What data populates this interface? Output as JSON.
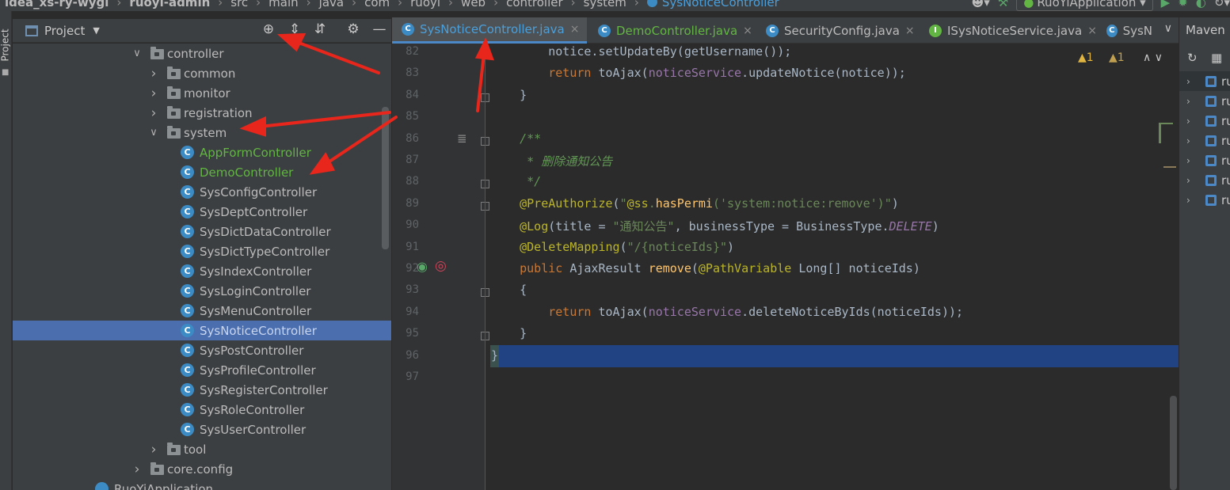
{
  "breadcrumb": {
    "items": [
      "idea_xs-ry-wygl",
      "ruoyi-admin",
      "src",
      "main",
      "java",
      "com",
      "ruoyi",
      "web",
      "controller",
      "system"
    ],
    "current": "SysNoticeController"
  },
  "run_config": "RuoYiApplication",
  "project_panel": {
    "title": "Project",
    "tree": [
      {
        "label": "controller",
        "type": "folder",
        "depth": 0,
        "expanded": true
      },
      {
        "label": "common",
        "type": "folder",
        "depth": 1,
        "expanded": false
      },
      {
        "label": "monitor",
        "type": "folder",
        "depth": 1,
        "expanded": false
      },
      {
        "label": "registration",
        "type": "folder",
        "depth": 1,
        "expanded": false
      },
      {
        "label": "system",
        "type": "folder",
        "depth": 1,
        "expanded": true
      },
      {
        "label": "AppFormController",
        "type": "class",
        "depth": 2,
        "color": "#62b543"
      },
      {
        "label": "DemoController",
        "type": "class",
        "depth": 2,
        "color": "#62b543"
      },
      {
        "label": "SysConfigController",
        "type": "class",
        "depth": 2
      },
      {
        "label": "SysDeptController",
        "type": "class",
        "depth": 2
      },
      {
        "label": "SysDictDataController",
        "type": "class",
        "depth": 2
      },
      {
        "label": "SysDictTypeController",
        "type": "class",
        "depth": 2
      },
      {
        "label": "SysIndexController",
        "type": "class",
        "depth": 2
      },
      {
        "label": "SysLoginController",
        "type": "class",
        "depth": 2
      },
      {
        "label": "SysMenuController",
        "type": "class",
        "depth": 2
      },
      {
        "label": "SysNoticeController",
        "type": "class",
        "depth": 2,
        "selected": true
      },
      {
        "label": "SysPostController",
        "type": "class",
        "depth": 2
      },
      {
        "label": "SysProfileController",
        "type": "class",
        "depth": 2
      },
      {
        "label": "SysRegisterController",
        "type": "class",
        "depth": 2
      },
      {
        "label": "SysRoleController",
        "type": "class",
        "depth": 2
      },
      {
        "label": "SysUserController",
        "type": "class",
        "depth": 2
      },
      {
        "label": "tool",
        "type": "folder",
        "depth": 1,
        "expanded": false
      },
      {
        "label": "core.config",
        "type": "folder",
        "depth": 0,
        "expanded": false
      },
      {
        "label": "RuoYiApplication",
        "type": "app",
        "depth": 0
      }
    ]
  },
  "tabs": [
    {
      "label": "SysNoticeController.java",
      "icon": "C",
      "active": true,
      "closable": true
    },
    {
      "label": "DemoController.java",
      "icon": "C",
      "closable": true,
      "color": "#62b543"
    },
    {
      "label": "SecurityConfig.java",
      "icon": "C",
      "closable": true
    },
    {
      "label": "ISysNoticeService.java",
      "icon": "I",
      "closable": true
    },
    {
      "label": "SysN",
      "icon": "C"
    }
  ],
  "editor": {
    "line_numbers": [
      "82",
      "83",
      "84",
      "85",
      "86",
      "87",
      "88",
      "89",
      "90",
      "91",
      "92",
      "93",
      "94",
      "95",
      "96",
      "97"
    ],
    "lines": [
      "        notice.setUpdateBy(getUsername());",
      "        return toAjax(noticeService.updateNotice(notice));",
      "    }",
      "",
      "    /**",
      "     * 删除通知公告",
      "     */",
      "    @PreAuthorize(\"@ss.hasPermi('system:notice:remove')\")",
      "    @Log(title = \"通知公告\", businessType = BusinessType.DELETE)",
      "    @DeleteMapping(\"/{noticeIds}\")",
      "    public AjaxResult remove(@PathVariable Long[] noticeIds)",
      "    {",
      "        return toAjax(noticeService.deleteNoticeByIds(noticeIds));",
      "    }",
      "}",
      ""
    ],
    "inspections": {
      "errors": "1",
      "warnings": "1"
    }
  },
  "maven_panel": {
    "title": "Maven",
    "items": [
      "ru",
      "ru",
      "ru",
      "ru",
      "ru",
      "ru",
      "ru"
    ]
  },
  "colors": {
    "accent": "#4a88c7",
    "selection": "#4b6eaf",
    "annotation_arrow": "#e8261b"
  }
}
